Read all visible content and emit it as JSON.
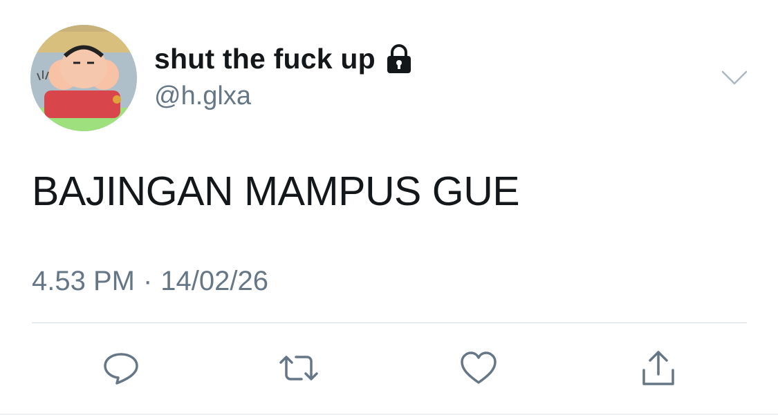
{
  "tweet": {
    "display_name": "shut the fuck up",
    "username": "@h.glxa",
    "text": "BAJINGAN MAMPUS GUE",
    "time": "4.53 PM",
    "separator": "·",
    "date": "14/02/26",
    "protected_icon": "lock-icon",
    "menu_icon": "chevron-down-icon"
  },
  "actions": [
    {
      "name": "reply",
      "icon": "speech-bubble-icon"
    },
    {
      "name": "retweet",
      "icon": "retweet-icon"
    },
    {
      "name": "like",
      "icon": "heart-icon"
    },
    {
      "name": "share",
      "icon": "share-icon"
    }
  ],
  "colors": {
    "text_primary": "#14171a",
    "text_secondary": "#657786",
    "icon_gray": "#657786",
    "divider": "#d5dde2"
  }
}
